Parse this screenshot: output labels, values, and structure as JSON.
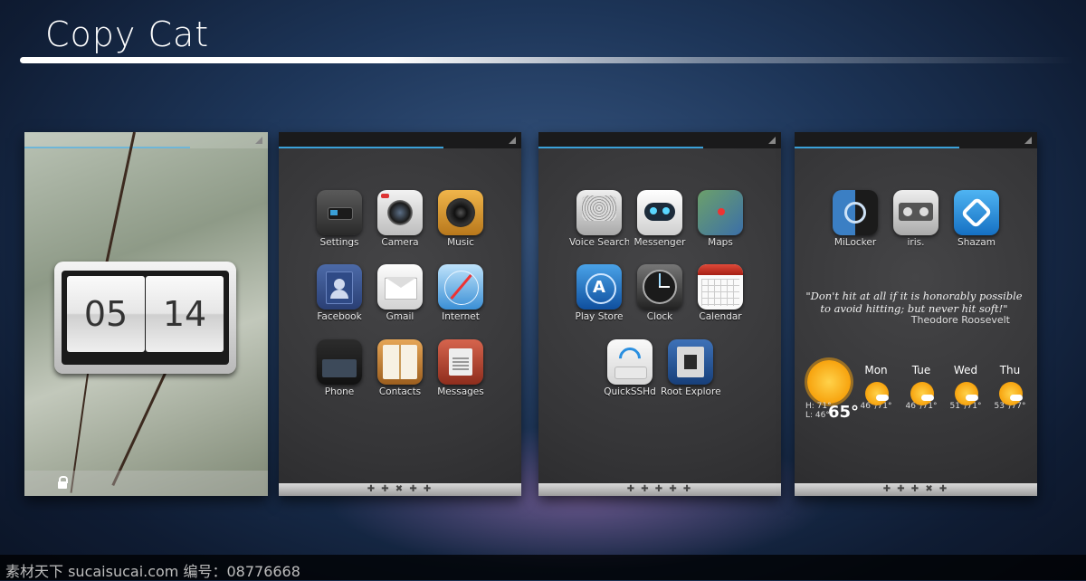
{
  "header": {
    "title": "Copy Cat"
  },
  "lockscreen": {
    "hour": "05",
    "minute": "14"
  },
  "screen2": {
    "apps": [
      {
        "label": "Settings",
        "icon": "settings-icon"
      },
      {
        "label": "Camera",
        "icon": "camera-icon"
      },
      {
        "label": "Music",
        "icon": "music-icon"
      },
      {
        "label": "Facebook",
        "icon": "facebook-icon"
      },
      {
        "label": "Gmail",
        "icon": "gmail-icon"
      },
      {
        "label": "Internet",
        "icon": "internet-icon"
      },
      {
        "label": "Phone",
        "icon": "phone-icon"
      },
      {
        "label": "Contacts",
        "icon": "contacts-icon"
      },
      {
        "label": "Messages",
        "icon": "messages-icon"
      }
    ],
    "dots": "✚ ✚ ✖ ✚ ✚"
  },
  "screen3": {
    "apps": [
      {
        "label": "Voice Search",
        "icon": "voice-search-icon"
      },
      {
        "label": "Messenger",
        "icon": "messenger-icon"
      },
      {
        "label": "Maps",
        "icon": "maps-icon"
      },
      {
        "label": "Play Store",
        "icon": "play-store-icon"
      },
      {
        "label": "Clock",
        "icon": "clock-icon"
      },
      {
        "label": "Calendar",
        "icon": "calendar-icon"
      },
      {
        "label": "QuickSSHd",
        "icon": "wifi-icon"
      },
      {
        "label": "Root Explorer",
        "icon": "root-explorer-icon"
      }
    ],
    "dots": "✚ ✚ ✚ ✚ ✚"
  },
  "screen4": {
    "apps": [
      {
        "label": "MiLocker",
        "icon": "milocker-icon"
      },
      {
        "label": "iris.",
        "icon": "iris-icon"
      },
      {
        "label": "Shazam",
        "icon": "shazam-icon"
      }
    ],
    "quote": "\"Don't hit at all if it is honorably possible to avoid hitting; but never hit soft!\"",
    "author": "Theodore Roosevelt",
    "weather": {
      "high": "H: 71°",
      "low": "L: 46°",
      "current": "65°",
      "days": [
        {
          "name": "Mon",
          "temps": "46°/71°"
        },
        {
          "name": "Tue",
          "temps": "46°/71°"
        },
        {
          "name": "Wed",
          "temps": "51°/71°"
        },
        {
          "name": "Thu",
          "temps": "53°/77°"
        }
      ]
    },
    "dots": "✚ ✚ ✚ ✖ ✚"
  },
  "watermark": "素材天下 sucaisucai.com  编号：08776668"
}
